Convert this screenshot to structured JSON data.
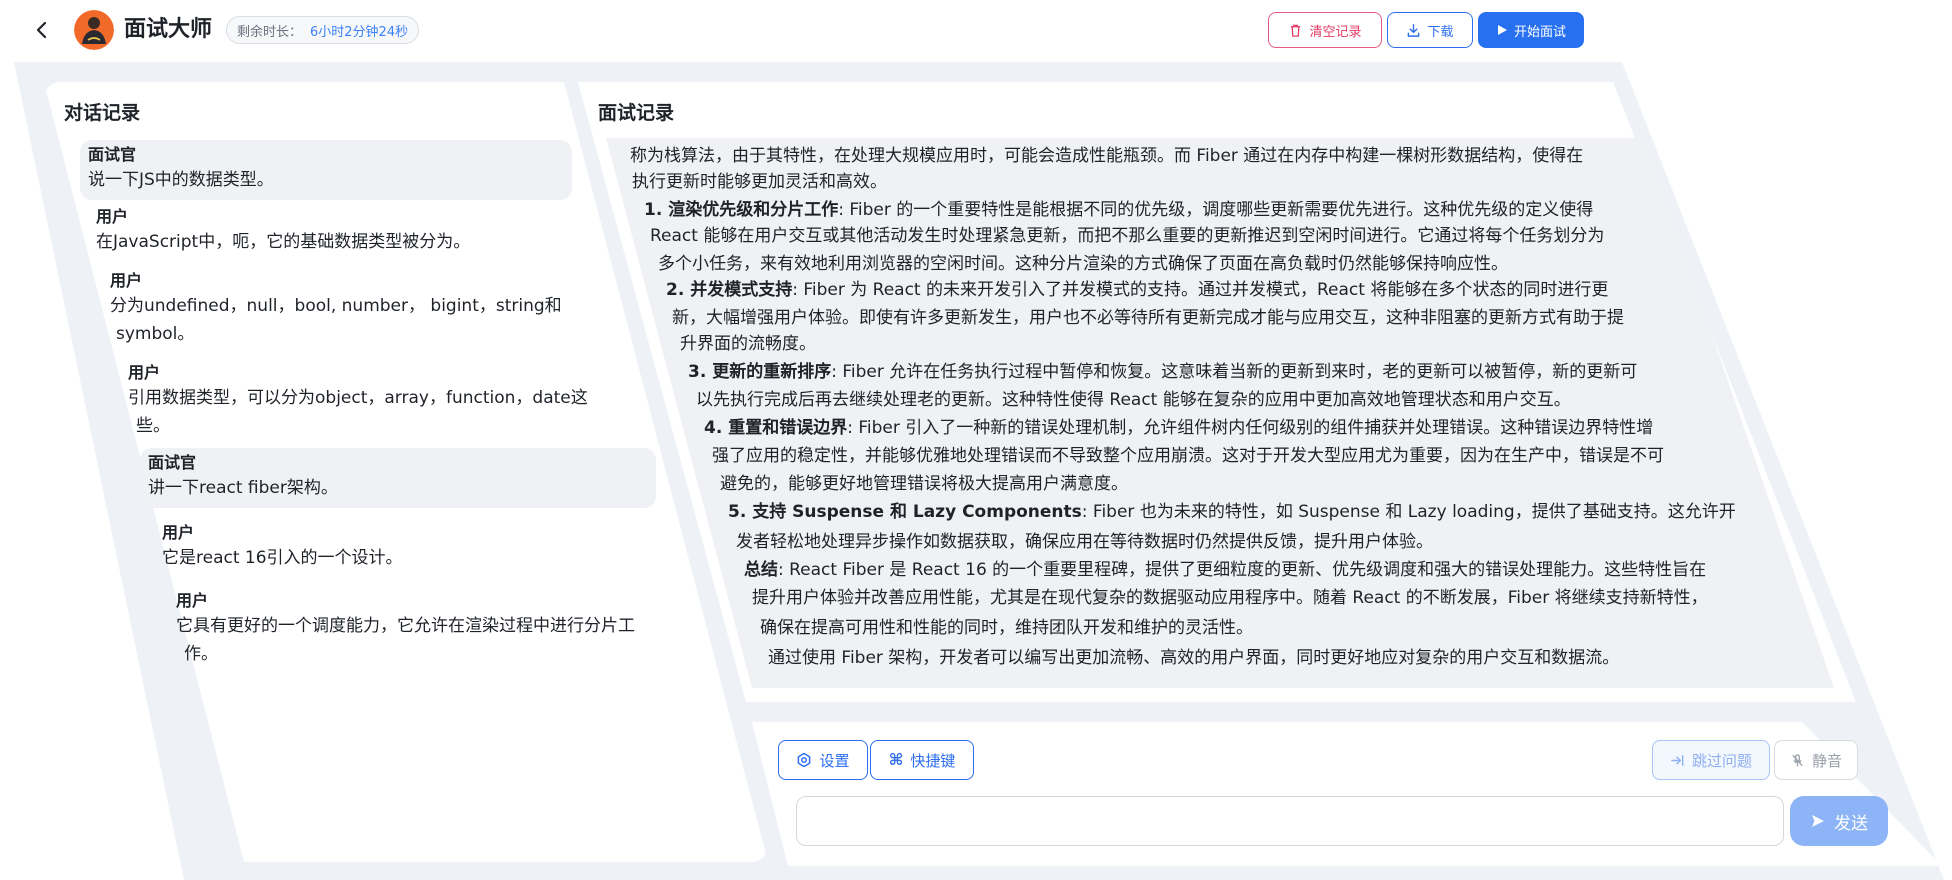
{
  "header": {
    "title": "面试大师",
    "timer_label": "剩余时长：",
    "timer_value": "6小时2分钟24秒",
    "clear_label": "清空记录",
    "download_label": "下载",
    "start_label": "开始面试"
  },
  "left_panel": {
    "title": "对话记录",
    "messages": [
      {
        "role": "面试官",
        "lines": [
          "说一下JS中的数据类型。"
        ]
      },
      {
        "role": "用户",
        "lines": [
          "在JavaScript中，呃，它的基础数据类型被分为。"
        ]
      },
      {
        "role": "用户",
        "lines": [
          "分为undefined，null，bool, number， bigint，string和",
          "symbol。"
        ]
      },
      {
        "role": "用户",
        "lines": [
          "引用数据类型，可以分为object，array，function，date这",
          "些。"
        ]
      },
      {
        "role": "面试官",
        "lines": [
          "讲一下react fiber架构。"
        ]
      },
      {
        "role": "用户",
        "lines": [
          "它是react 16引入的一个设计。"
        ]
      },
      {
        "role": "用户",
        "lines": [
          "它具有更好的一个调度能力，它允许在渲染过程中进行分片工",
          "作。"
        ]
      }
    ]
  },
  "right_panel": {
    "title": "面试记录",
    "lines": [
      {
        "bold": "",
        "text": "称为栈算法，由于其特性，在处理大规模应用时，可能会造成性能瓶颈。而 Fiber 通过在内存中构建一棵树形数据结构，使得在"
      },
      {
        "bold": "",
        "text": "执行更新时能够更加灵活和高效。"
      },
      {
        "bold": "1. 渲染优先级和分片工作",
        "text": ": Fiber 的一个重要特性是能根据不同的优先级，调度哪些更新需要优先进行。这种优先级的定义使得"
      },
      {
        "bold": "",
        "text": "React 能够在用户交互或其他活动发生时处理紧急更新，而把不那么重要的更新推迟到空闲时间进行。它通过将每个任务划分为"
      },
      {
        "bold": "",
        "text": "多个小任务，来有效地利用浏览器的空闲时间。这种分片渲染的方式确保了页面在高负载时仍然能够保持响应性。"
      },
      {
        "bold": "2. 并发模式支持",
        "text": ": Fiber 为 React 的未来开发引入了并发模式的支持。通过并发模式，React 将能够在多个状态的同时进行更"
      },
      {
        "bold": "",
        "text": "新，大幅增强用户体验。即使有许多更新发生，用户也不必等待所有更新完成才能与应用交互，这种非阻塞的更新方式有助于提"
      },
      {
        "bold": "",
        "text": "升界面的流畅度。"
      },
      {
        "bold": "3. 更新的重新排序",
        "text": ": Fiber 允许在任务执行过程中暂停和恢复。这意味着当新的更新到来时，老的更新可以被暂停，新的更新可"
      },
      {
        "bold": "",
        "text": "以先执行完成后再去继续处理老的更新。这种特性使得 React 能够在复杂的应用中更加高效地管理状态和用户交互。"
      },
      {
        "bold": "4. 重置和错误边界",
        "text": ": Fiber 引入了一种新的错误处理机制，允许组件树内任何级别的组件捕获并处理错误。这种错误边界特性增"
      },
      {
        "bold": "",
        "text": "强了应用的稳定性，并能够优雅地处理错误而不导致整个应用崩溃。这对于开发大型应用尤为重要，因为在生产中，错误是不可"
      },
      {
        "bold": "",
        "text": "避免的，能够更好地管理错误将极大提高用户满意度。"
      },
      {
        "bold": "5. 支持 Suspense 和 Lazy Components",
        "text": ": Fiber 也为未来的特性，如 Suspense 和 Lazy loading，提供了基础支持。这允许开"
      },
      {
        "bold": "",
        "text": "发者轻松地处理异步操作如数据获取，确保应用在等待数据时仍然提供反馈，提升用户体验。"
      },
      {
        "bold": "总结",
        "text": ": React Fiber 是 React 16 的一个重要里程碑，提供了更细粒度的更新、优先级调度和强大的错误处理能力。这些特性旨在"
      },
      {
        "bold": "",
        "text": "提升用户体验并改善应用性能，尤其是在现代复杂的数据驱动应用程序中。随着 React 的不断发展，Fiber 将继续支持新特性，"
      },
      {
        "bold": "",
        "text": "确保在提高可用性和性能的同时，维持团队开发和维护的灵活性。"
      },
      {
        "bold": "",
        "text": "通过使用 Fiber 架构，开发者可以编写出更加流畅、高效的用户界面，同时更好地应对复杂的用户交互和数据流。"
      }
    ]
  },
  "input_panel": {
    "settings_label": "设置",
    "shortcut_label": "快捷键",
    "skip_label": "跳过问题",
    "mute_label": "静音",
    "input_value": "",
    "send_label": "发送"
  },
  "colors": {
    "primary": "#2770f0",
    "danger": "#e23b64",
    "panel_bg": "#f0f1f4",
    "stage_bg": "#eef1f6"
  }
}
